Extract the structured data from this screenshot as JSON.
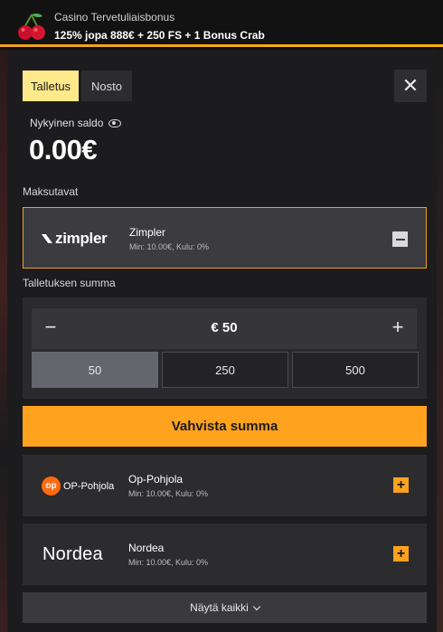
{
  "promo": {
    "title": "Casino Tervetuliaisbonus",
    "subtitle": "125% jopa 888€ + 250 FS + 1 Bonus Crab"
  },
  "tabs": [
    {
      "label": "Talletus",
      "active": true
    },
    {
      "label": "Nosto",
      "active": false
    }
  ],
  "close_label": "✕",
  "balance": {
    "label": "Nykyinen saldo",
    "value": "0.00€"
  },
  "payment_methods_label": "Maksutavat",
  "selected_method": {
    "logo_text": "zimpler",
    "name": "Zimpler",
    "info": "Min: 10.00€, Kulu: 0%"
  },
  "amount": {
    "label": "Talletuksen summa",
    "minus": "−",
    "plus": "+",
    "value": "€ 50",
    "presets": [
      {
        "label": "50",
        "active": true
      },
      {
        "label": "250",
        "active": false
      },
      {
        "label": "500",
        "active": false
      }
    ]
  },
  "confirm_label": "Vahvista summa",
  "other_methods": [
    {
      "logo_text": "OP-Pohjola",
      "logo_mark": "op",
      "name": "Op-Pohjola",
      "info": "Min: 10.00€, Kulu: 0%"
    },
    {
      "logo_text": "Nordea",
      "name": "Nordea",
      "info": "Min: 10.00€, Kulu: 0%"
    }
  ],
  "show_all_label": "Näytä kaikki",
  "colors": {
    "accent": "#ffa21e",
    "tab_active": "#ffe98a",
    "modal_bg": "#1c1c1e"
  }
}
